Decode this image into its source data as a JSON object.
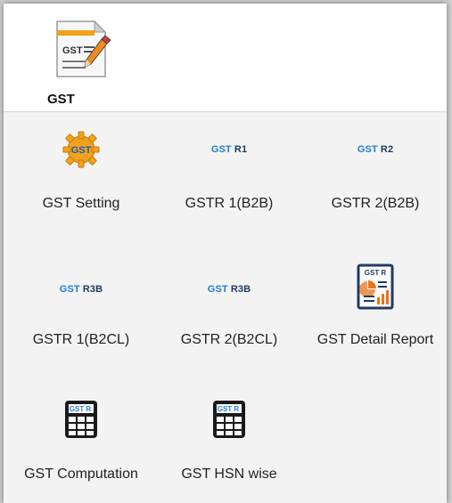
{
  "header": {
    "title": "GST",
    "icon": "gst-document-pencil-icon",
    "icon_text": "GST"
  },
  "tiles": [
    {
      "label": "GST Setting",
      "icon": "gst-gear-icon",
      "icon_text": "GST"
    },
    {
      "label": "GSTR 1(B2B)",
      "icon": "gst-r1-icon",
      "tag_a": "GST",
      "tag_b": "R1"
    },
    {
      "label": "GSTR 2(B2B)",
      "icon": "gst-r2-icon",
      "tag_a": "GST",
      "tag_b": "R2"
    },
    {
      "label": "GSTR 1(B2CL)",
      "icon": "gst-r3b-icon",
      "tag_a": "GST",
      "tag_b": "R3B"
    },
    {
      "label": "GSTR 2(B2CL)",
      "icon": "gst-r3b-icon",
      "tag_a": "GST",
      "tag_b": "R3B"
    },
    {
      "label": "GST Detail Report",
      "icon": "gst-detail-report-icon",
      "icon_text": "GST R"
    },
    {
      "label": "GST Computation",
      "icon": "gst-calculator-icon",
      "icon_text": "GST R"
    },
    {
      "label": "GST HSN wise",
      "icon": "gst-calculator-icon",
      "icon_text": "GST R"
    }
  ],
  "colors": {
    "accent_blue": "#1e7fd6",
    "gear_orange": "#f2a11d",
    "navy": "#1f3b64",
    "report_orange": "#e8741c"
  }
}
